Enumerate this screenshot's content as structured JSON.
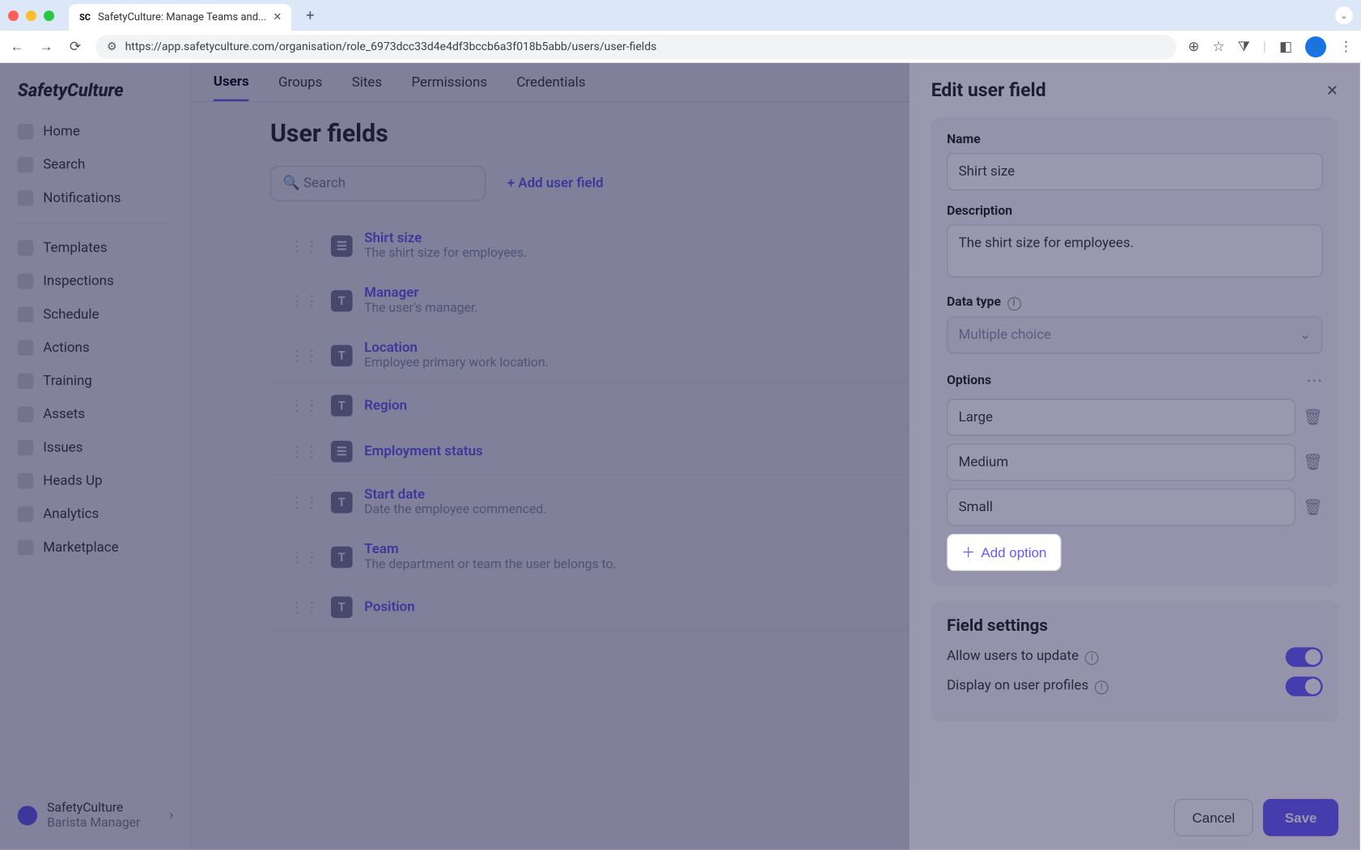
{
  "browser": {
    "tab_title": "SafetyCulture: Manage Teams and...",
    "url": "https://app.safetyculture.com/organisation/role_6973dcc33d4e4df3bccb6a3f018b5abb/users/user-fields"
  },
  "sidebar": {
    "logo": "SafetyCulture",
    "items_top": [
      {
        "label": "Home"
      },
      {
        "label": "Search"
      },
      {
        "label": "Notifications"
      }
    ],
    "items_mid": [
      {
        "label": "Templates"
      },
      {
        "label": "Inspections"
      },
      {
        "label": "Schedule"
      },
      {
        "label": "Actions"
      },
      {
        "label": "Training"
      },
      {
        "label": "Assets"
      },
      {
        "label": "Issues"
      },
      {
        "label": "Heads Up"
      },
      {
        "label": "Analytics"
      },
      {
        "label": "Marketplace"
      }
    ],
    "footer": {
      "org": "SafetyCulture",
      "role": "Barista Manager"
    }
  },
  "main_tabs": {
    "items": [
      "Users",
      "Groups",
      "Sites",
      "Permissions",
      "Credentials"
    ],
    "active": "Users"
  },
  "page": {
    "title": "User fields",
    "search_placeholder": "Search",
    "add_link": "Add user field",
    "fields": [
      {
        "name": "Shirt size",
        "description": "The shirt size for employees."
      },
      {
        "name": "Manager",
        "description": "The user's manager."
      },
      {
        "name": "Location",
        "description": "Employee primary work location."
      },
      {
        "name": "Region",
        "description": ""
      },
      {
        "name": "Employment status",
        "description": ""
      },
      {
        "name": "Start date",
        "description": "Date the employee commenced."
      },
      {
        "name": "Team",
        "description": "The department or team the user belongs to."
      },
      {
        "name": "Position",
        "description": ""
      }
    ]
  },
  "panel": {
    "title": "Edit user field",
    "name_label": "Name",
    "name_value": "Shirt size",
    "description_label": "Description",
    "description_value": "The shirt size for employees.",
    "data_type_label": "Data type",
    "data_type_value": "Multiple choice",
    "options_label": "Options",
    "options": [
      "Large",
      "Medium",
      "Small"
    ],
    "add_option_label": "Add option",
    "settings_title": "Field settings",
    "setting_allow": "Allow users to update",
    "setting_display": "Display on user profiles",
    "cancel": "Cancel",
    "save": "Save"
  }
}
